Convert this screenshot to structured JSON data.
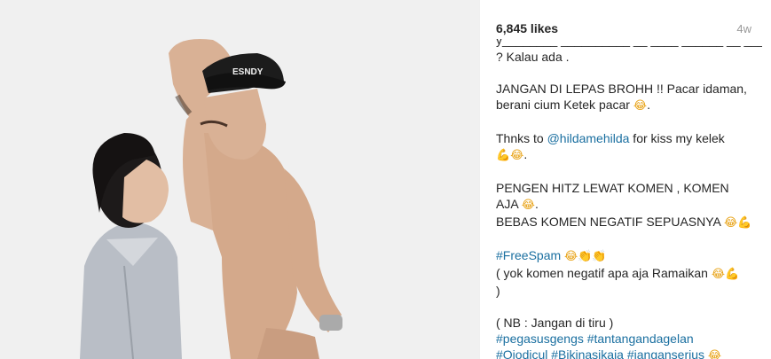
{
  "post": {
    "likes": "6,845 likes",
    "age": "4w"
  },
  "photo": {
    "cap_text": "ESNDY",
    "background_color": "#ececec"
  },
  "caption": {
    "cut_line": "y________ __________ __ ____ ______ __ _______ _",
    "lines": [
      {
        "text": "? Kalau ada ."
      },
      {
        "gap": true
      },
      {
        "text": "JANGAN DI LEPAS BROHH !! Pacar idaman,"
      },
      {
        "text": "berani cium Ketek pacar ",
        "emoji": "😂",
        "after": "."
      },
      {
        "gap": true
      },
      {
        "pre": "Thnks to ",
        "mention": "@hildamehilda",
        "text": " for kiss my kelek"
      },
      {
        "emoji": "💪😂",
        "after": "."
      },
      {
        "gap": true
      },
      {
        "text": "PENGEN HITZ LEWAT KOMEN , KOMEN"
      },
      {
        "text": "AJA ",
        "emoji": "😂",
        "after": "."
      },
      {
        "text": "BEBAS KOMEN NEGATIF SEPUASNYA ",
        "emoji": "😂💪"
      },
      {
        "gap": true
      },
      {
        "mention": "#FreeSpam",
        "text": " ",
        "emoji": "😂👏👏"
      },
      {
        "text": "( yok komen negatif apa aja Ramaikan ",
        "emoji": "😂💪"
      },
      {
        "text": ")"
      },
      {
        "gap": true
      },
      {
        "text": "( NB : Jangan di tiru )"
      },
      {
        "mention": "#pegasusgengs #tantangandagelan"
      },
      {
        "mention": "#Ojodicul #Bikinasikaja #janganserius",
        "text": " ",
        "emoji": "😂"
      }
    ]
  },
  "colors": {
    "link": "#1a6fa0",
    "muted": "#999999",
    "text": "#262626"
  }
}
